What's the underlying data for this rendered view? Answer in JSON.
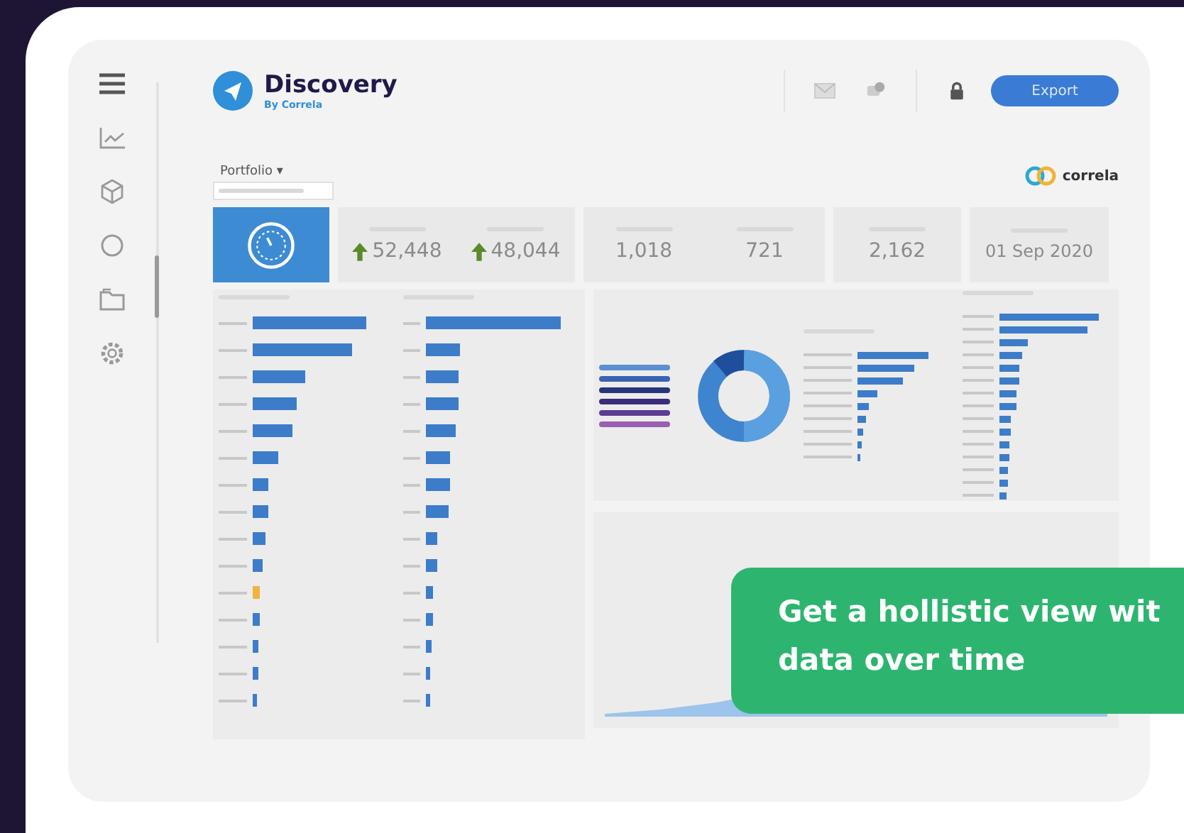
{
  "app": {
    "name": "Discovery",
    "byline": "By Correla"
  },
  "header": {
    "export_button": "Export"
  },
  "filter": {
    "label": "Portfolio ▾"
  },
  "brand_logo": {
    "text": "correla"
  },
  "kpis": [
    {
      "kind": "metric",
      "values": [
        "52,448",
        "48,044"
      ]
    },
    {
      "kind": "plain",
      "values": [
        "1,018",
        "721"
      ]
    },
    {
      "kind": "plain",
      "values": [
        "2,162"
      ]
    },
    {
      "kind": "plain",
      "values": [
        "01 Sep 2020"
      ]
    }
  ],
  "callout": {
    "lines": [
      "Get a hollistic view wit",
      "data over time"
    ]
  }
}
